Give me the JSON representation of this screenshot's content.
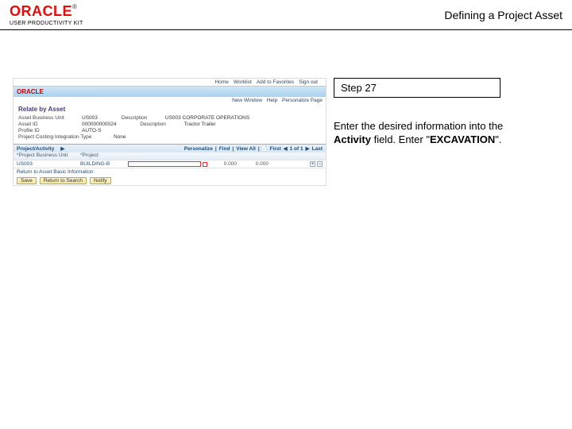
{
  "header": {
    "brand": "ORACLE",
    "reg": "®",
    "product": "USER PRODUCTIVITY KIT",
    "doc_title": "Defining a Project Asset"
  },
  "panel": {
    "step_label": "Step 27",
    "instruction_prefix": "Enter the desired information into the ",
    "field_name": "Activity",
    "instruction_mid": " field. Enter \"",
    "entry_value": "EXCAVATION",
    "instruction_suffix": "\"."
  },
  "shot": {
    "topnav": {
      "home": "Home",
      "worklist": "Worklist",
      "add_fav": "Add to Favorites",
      "sign_out": "Sign out"
    },
    "headerbar": {
      "brand": "ORACLE"
    },
    "sublinks": {
      "new_window": "New Window",
      "help": "Help",
      "personalize": "Personalize Page"
    },
    "page_title": "Relate by Asset",
    "fields": {
      "business_unit_lbl": "Asset Business Unit",
      "business_unit_val": "US003",
      "desc_lbl": "Description",
      "desc_val": "US003 CORPORATE OPERATIONS",
      "asset_id_lbl": "Asset ID",
      "asset_id_val": "000000000024",
      "desc2_lbl": "Description",
      "desc2_val": "Tractor Trailer",
      "profile_lbl": "Profile ID",
      "profile_val": "AUTO-S",
      "project_type_lbl": "Project Costing Integration Type",
      "project_type_val": "None"
    },
    "table": {
      "tab_label": "Project/Activity",
      "personalize": "Personalize",
      "find": "Find",
      "view_all": "View All",
      "pager_first": "First",
      "pager_range": "1 of 1",
      "pager_last": "Last",
      "col1": "*Project Business Unit",
      "col2": "*Project",
      "row_bu": "US003",
      "row_proj": "BUILDING-B",
      "money1": "0.000",
      "money2": "0.000",
      "asset_link": "Return to Asset Basic Information"
    },
    "buttons": {
      "save": "Save",
      "return": "Return to Search",
      "notify": "Notify"
    }
  }
}
